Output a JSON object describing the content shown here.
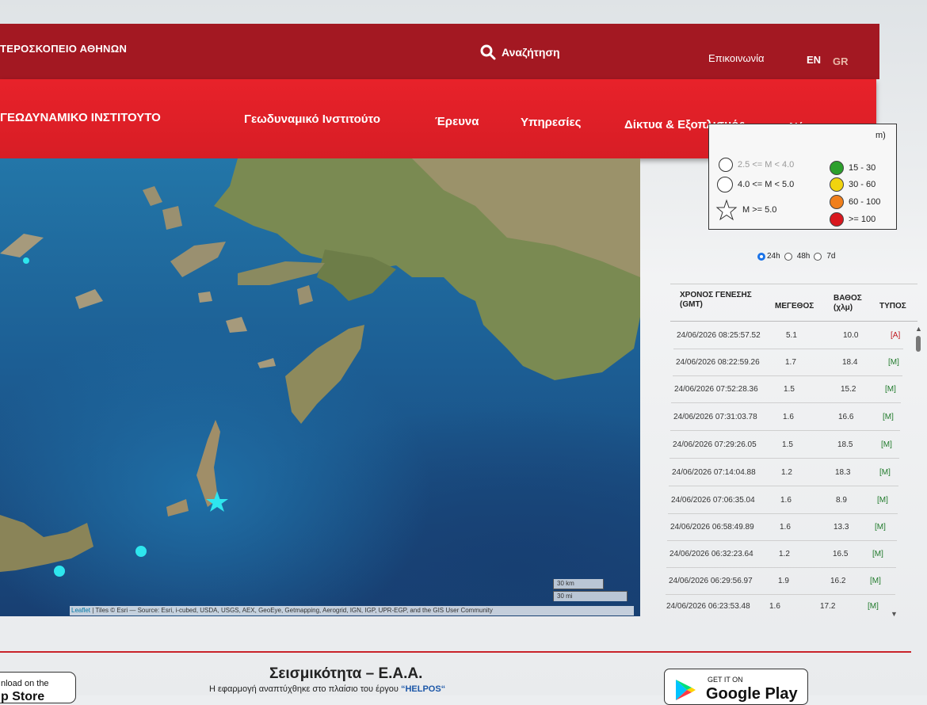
{
  "header": {
    "site_name": "ΤΕΡΟΣΚΟΠΕΙΟ ΑΘΗΝΩΝ",
    "search_label": "Αναζήτηση",
    "contact_label": "Επικοινωνία",
    "lang_en": "EN",
    "lang_gr": "GR"
  },
  "nav": {
    "institute": "ΓΕΩΔΥΝΑΜΙΚΟ ΙΝΣΤΙΤΟΥΤΟ",
    "items": [
      "Γεωδυναμικό Ινστιτούτο",
      "Έρευνα",
      "Υπηρεσίες",
      "Δίκτυα & Εξοπλισμός",
      "Νέα"
    ],
    "arrow_icon": "arrow-down-icon"
  },
  "map": {
    "attribution_leaflet": "Leaflet",
    "attribution_text": "| Tiles © Esri — Source: Esri, i-cubed, USDA, USGS, AEX, GeoEye, Getmapping, Aerogrid, IGN, IGP, UPR-EGP, and the GIS User Community",
    "scale_km": "30 km",
    "scale_mi": "30 mi",
    "marker_color": "#2ee6ee"
  },
  "legend": {
    "partial_top": "m)",
    "partial_row": "2.5 <= M < 4.0",
    "rows": [
      "4.0 <= M < 5.0",
      "M >= 5.0"
    ],
    "depths": [
      {
        "label": "15 - 30",
        "color": "#2ca02c"
      },
      {
        "label": "30 - 60",
        "color": "#f1d40f"
      },
      {
        "label": "60 - 100",
        "color": "#f07f1c"
      },
      {
        "label": ">= 100",
        "color": "#d9181e"
      }
    ]
  },
  "period": {
    "options": [
      "24h",
      "48h",
      "7d"
    ],
    "selected": "24h"
  },
  "table": {
    "headers": {
      "time_line1": "ΧΡΟΝΟΣ ΓΕΝΕΣΗΣ",
      "time_line2": "(GMT)",
      "magnitude": "ΜΕΓΕΘΟΣ",
      "depth_line1": "ΒΑΘΟΣ",
      "depth_line2": "(χλμ)",
      "type": "ΤΥΠΟΣ"
    },
    "rows": [
      {
        "time": "24/06/2026 08:25:57.52",
        "mag": "5.1",
        "depth": "10.0",
        "type": "[A]"
      },
      {
        "time": "24/06/2026 08:22:59.26",
        "mag": "1.7",
        "depth": "18.4",
        "type": "[M]"
      },
      {
        "time": "24/06/2026 07:52:28.36",
        "mag": "1.5",
        "depth": "15.2",
        "type": "[M]"
      },
      {
        "time": "24/06/2026 07:31:03.78",
        "mag": "1.6",
        "depth": "16.6",
        "type": "[M]"
      },
      {
        "time": "24/06/2026 07:29:26.05",
        "mag": "1.5",
        "depth": "18.5",
        "type": "[M]"
      },
      {
        "time": "24/06/2026 07:14:04.88",
        "mag": "1.2",
        "depth": "18.3",
        "type": "[M]"
      },
      {
        "time": "24/06/2026 07:06:35.04",
        "mag": "1.6",
        "depth": "8.9",
        "type": "[M]"
      },
      {
        "time": "24/06/2026 06:58:49.89",
        "mag": "1.6",
        "depth": "13.3",
        "type": "[M]"
      },
      {
        "time": "24/06/2026 06:32:23.64",
        "mag": "1.2",
        "depth": "16.5",
        "type": "[M]"
      },
      {
        "time": "24/06/2026 06:29:56.97",
        "mag": "1.9",
        "depth": "16.2",
        "type": "[M]"
      },
      {
        "time": "24/06/2026 06:23:53.48",
        "mag": "1.6",
        "depth": "17.2",
        "type": "[M]"
      }
    ]
  },
  "footer": {
    "title": "Σεισμικότητα – Ε.Α.Α.",
    "subtitle_prefix": "Η εφαρμογή αναπτύχθηκε στο πλαίσιο του έργου",
    "subtitle_project": "“HELPOS“",
    "appstore_label": "nload on the",
    "appstore_partial": "p Store",
    "googleplay_small": "GET IT ON",
    "googleplay_big": "Google Play"
  }
}
